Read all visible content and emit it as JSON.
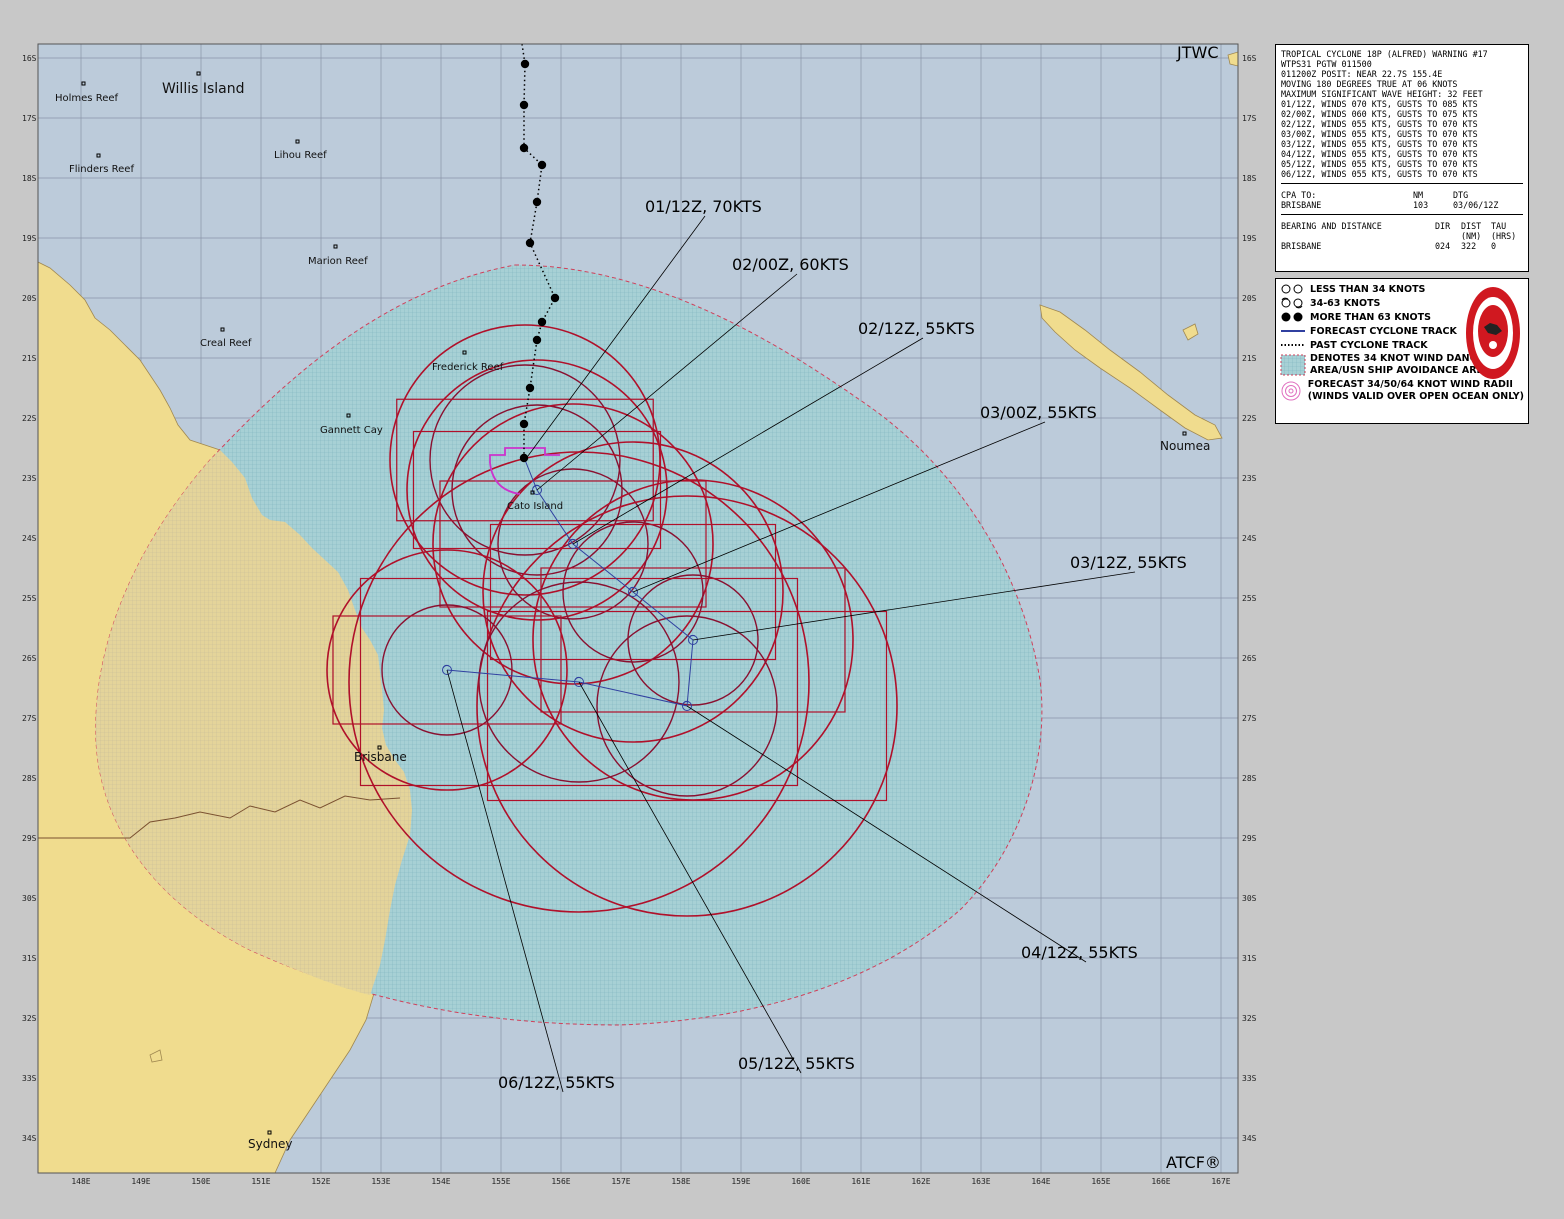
{
  "header": {
    "agency": "JTWC",
    "footer_mark": "ATCF®"
  },
  "warning": {
    "lines": [
      "TROPICAL CYCLONE 18P (ALFRED) WARNING #17",
      "WTPS31 PGTW 011500",
      "011200Z POSIT: NEAR 22.7S 155.4E",
      "MOVING 180 DEGREES TRUE AT 06 KNOTS",
      "MAXIMUM SIGNIFICANT WAVE HEIGHT: 32 FEET",
      "01/12Z, WINDS 070 KTS, GUSTS TO 085 KTS",
      "02/00Z, WINDS 060 KTS, GUSTS TO 075 KTS",
      "02/12Z, WINDS 055 KTS, GUSTS TO 070 KTS",
      "03/00Z, WINDS 055 KTS, GUSTS TO 070 KTS",
      "03/12Z, WINDS 055 KTS, GUSTS TO 070 KTS",
      "04/12Z, WINDS 055 KTS, GUSTS TO 070 KTS",
      "05/12Z, WINDS 055 KTS, GUSTS TO 070 KTS",
      "06/12Z, WINDS 055 KTS, GUSTS TO 070 KTS"
    ],
    "cpa": {
      "label": "CPA TO:",
      "nm_header": "NM",
      "dtg_header": "DTG",
      "place": "BRISBANE",
      "nm": "103",
      "dtg": "03/06/12Z"
    },
    "bearing": {
      "label": "BEARING AND DISTANCE",
      "dir_header": "DIR",
      "dist_header": "DIST",
      "tau_header": "TAU",
      "dist_unit": "(NM)",
      "tau_unit": "(HRS)",
      "place": "BRISBANE",
      "dir": "024",
      "dist": "322",
      "tau": "0"
    }
  },
  "legend": {
    "items": [
      {
        "icon": "low-wind-symbol-icon",
        "label": "LESS THAN 34 KNOTS"
      },
      {
        "icon": "mid-wind-symbol-icon",
        "label": "34-63 KNOTS"
      },
      {
        "icon": "high-wind-symbol-icon",
        "label": "MORE THAN 63 KNOTS"
      },
      {
        "icon": "forecast-track-line-icon",
        "label": "FORECAST CYCLONE TRACK"
      },
      {
        "icon": "past-track-line-icon",
        "label": "PAST CYCLONE TRACK"
      },
      {
        "icon": "danger-area-swatch-icon",
        "label": "DENOTES 34 KNOT WIND DANGER",
        "label2": "AREA/USN SHIP AVOIDANCE AREA"
      },
      {
        "icon": "wind-radii-icon",
        "label": "FORECAST 34/50/64 KNOT WIND RADII",
        "label2": "(WINDS VALID OVER OPEN OCEAN ONLY)"
      }
    ]
  },
  "axes": {
    "lon": [
      "148E",
      "149E",
      "150E",
      "151E",
      "152E",
      "153E",
      "154E",
      "155E",
      "156E",
      "157E",
      "158E",
      "159E",
      "160E",
      "161E",
      "162E",
      "163E",
      "164E",
      "165E",
      "166E",
      "167E"
    ],
    "lat": [
      "16S",
      "17S",
      "18S",
      "19S",
      "20S",
      "21S",
      "22S",
      "23S",
      "24S",
      "25S",
      "26S",
      "27S",
      "28S",
      "29S",
      "30S",
      "31S",
      "32S",
      "33S",
      "34S"
    ]
  },
  "places": {
    "willis_island": "Willis Island",
    "holmes_reef": "Holmes Reef",
    "flinders_reef": "Flinders Reef",
    "lihou_reef": "Lihou Reef",
    "marion_reef": "Marion Reef",
    "creal_reef": "Creal Reef",
    "frederick_reef": "Frederick Reef",
    "gannett_cay": "Gannett Cay",
    "cato_island": "Cato Island",
    "brisbane": "Brisbane",
    "sydney": "Sydney",
    "noumea": "Noumea"
  },
  "forecast_labels": [
    {
      "tau": "01/12Z",
      "text": "01/12Z,  70KTS",
      "lat": -22.7,
      "lon": 155.4
    },
    {
      "tau": "02/00Z",
      "text": "02/00Z,  60KTS",
      "lat": -23.2,
      "lon": 155.6
    },
    {
      "tau": "02/12Z",
      "text": "02/12Z,  55KTS",
      "lat": -24.1,
      "lon": 156.2
    },
    {
      "tau": "03/00Z",
      "text": "03/00Z,  55KTS",
      "lat": -24.9,
      "lon": 157.2
    },
    {
      "tau": "03/12Z",
      "text": "03/12Z,  55KTS",
      "lat": -25.7,
      "lon": 158.2
    },
    {
      "tau": "04/12Z",
      "text": "04/12Z,  55KTS",
      "lat": -26.8,
      "lon": 158.1
    },
    {
      "tau": "05/12Z",
      "text": "05/12Z,  55KTS",
      "lat": -26.4,
      "lon": 156.3
    },
    {
      "tau": "06/12Z",
      "text": "06/12Z,  55KTS",
      "lat": -26.2,
      "lon": 154.1
    }
  ],
  "colors": {
    "ocean": "#bccbda",
    "land": "#f0dc8e",
    "danger": "#9fcdd4",
    "radii": "#b0102a",
    "radii_inner": "#8a1030",
    "forecast_track": "#3040a0",
    "radii_64": "#cc33cc"
  }
}
